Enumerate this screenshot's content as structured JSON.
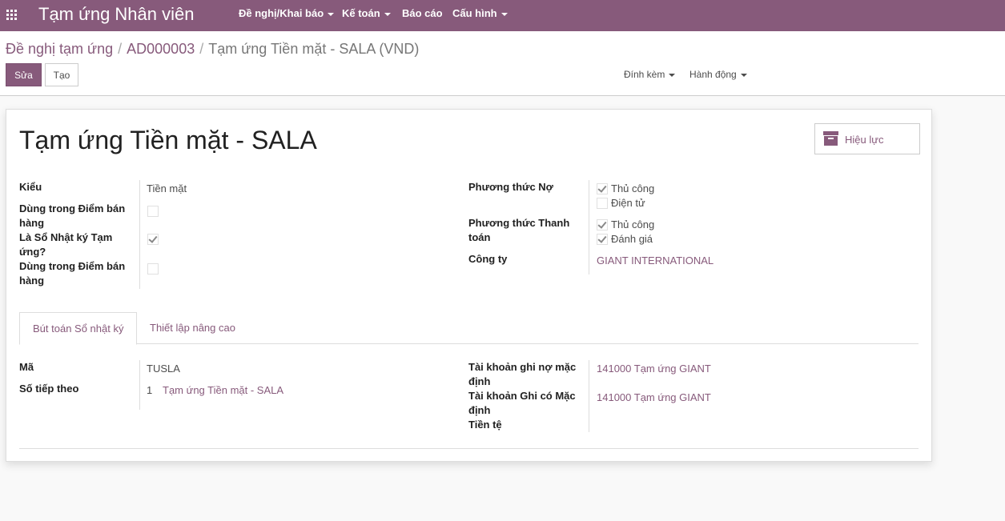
{
  "topbar": {
    "brand": "Tạm ứng Nhân viên",
    "menus": [
      "Đề nghị/Khai báo",
      "Kế toán",
      "Báo cáo",
      "Cấu hình"
    ]
  },
  "breadcrumb": {
    "items": [
      "Đề nghị tạm ứng",
      "AD000003"
    ],
    "current": "Tạm ứng Tiền mặt - SALA (VND)"
  },
  "buttons": {
    "edit": "Sửa",
    "create": "Tạo"
  },
  "dropdowns": {
    "attach": "Đính kèm",
    "action": "Hành động"
  },
  "form": {
    "title": "Tạm ứng Tiền mặt - SALA",
    "active_button": "Hiệu lực",
    "left": {
      "type_label": "Kiểu",
      "type_value": "Tiền mặt",
      "pos1_label": "Dùng trong Điểm bán hàng",
      "advance_journal_label": "Là Sổ Nhật ký Tạm ứng?",
      "pos2_label": "Dùng trong Điểm bán hàng"
    },
    "right": {
      "debit_method_label": "Phương thức Nợ",
      "debit_options": [
        "Thủ công",
        "Điện tử"
      ],
      "payment_method_label": "Phương thức Thanh toán",
      "payment_options": [
        "Thủ công",
        "Đánh giá"
      ],
      "company_label": "Công ty",
      "company_value": "GIANT INTERNATIONAL"
    }
  },
  "tabs": [
    "Bút toán Sổ nhật ký",
    "Thiết lập nâng cao"
  ],
  "tab_content": {
    "code_label": "Mã",
    "code_value": "TUSLA",
    "next_number_label": "Số tiếp theo",
    "next_number_value": "1",
    "next_number_link": "Tạm ứng Tiền mặt - SALA",
    "debit_account_label": "Tài khoản ghi nợ mặc định",
    "debit_account_value": "141000 Tạm ứng GIANT",
    "credit_account_label": "Tài khoản Ghi có Mặc định",
    "credit_account_value": "141000 Tạm ứng GIANT",
    "currency_label": "Tiền tệ"
  }
}
